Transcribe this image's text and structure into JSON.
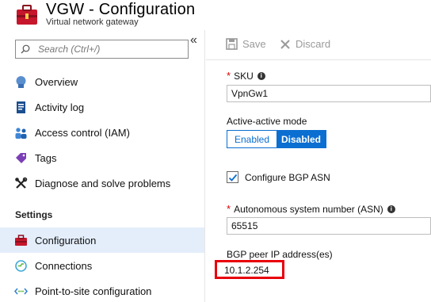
{
  "header": {
    "title": "VGW - Configuration",
    "subtitle": "Virtual network gateway",
    "logo_icon": "vpn-gateway-icon",
    "logo_color": "#c6162b"
  },
  "sidebar": {
    "collapse_glyph": "«",
    "search_placeholder": "Search (Ctrl+/)",
    "items": [
      {
        "label": "Overview",
        "icon": "overview-icon"
      },
      {
        "label": "Activity log",
        "icon": "activity-log-icon"
      },
      {
        "label": "Access control (IAM)",
        "icon": "people-icon"
      },
      {
        "label": "Tags",
        "icon": "tag-icon"
      },
      {
        "label": "Diagnose and solve problems",
        "icon": "wrench-icon"
      }
    ],
    "section_settings": "Settings",
    "settings_items": [
      {
        "label": "Configuration",
        "icon": "toolbox-icon",
        "active": true
      },
      {
        "label": "Connections",
        "icon": "connections-icon"
      },
      {
        "label": "Point-to-site configuration",
        "icon": "point-to-site-icon"
      }
    ],
    "active_bg": "#e4eefb"
  },
  "toolbar": {
    "save_label": "Save",
    "discard_label": "Discard"
  },
  "form": {
    "sku_label": "SKU",
    "sku_value": "VpnGw1",
    "active_active_label": "Active-active mode",
    "toggle_enabled": "Enabled",
    "toggle_disabled": "Disabled",
    "toggle_selected": "Disabled",
    "bgp_checkbox_label": "Configure BGP ASN",
    "bgp_checked": true,
    "asn_label": "Autonomous system number (ASN)",
    "asn_value": "65515",
    "bgp_peer_label": "BGP peer IP address(es)",
    "bgp_peer_value": "10.1.2.254",
    "accent": "#0b6ed1",
    "highlight_color": "#e8000b"
  }
}
